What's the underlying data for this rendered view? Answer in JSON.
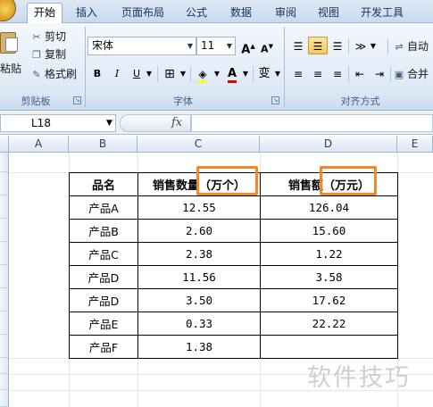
{
  "ribbon_tabs": [
    "开始",
    "插入",
    "页面布局",
    "公式",
    "数据",
    "审阅",
    "视图",
    "开发工具"
  ],
  "clipboard": {
    "paste_label": "粘贴",
    "cut": "剪切",
    "copy": "复制",
    "format_painter": "格式刷",
    "group_title": "剪贴板"
  },
  "font": {
    "name": "宋体",
    "size": "11",
    "grow": "A",
    "shrink": "A",
    "bold": "B",
    "italic": "I",
    "underline": "U",
    "color_letter": "A",
    "phonetic": "变",
    "group_title": "字体"
  },
  "alignment": {
    "wrap_label": "自动",
    "merge_label": "合并",
    "group_title": "对齐方式"
  },
  "formula_bar": {
    "name_box": "L18",
    "fx": "fx",
    "value": ""
  },
  "columns": [
    "A",
    "B",
    "C",
    "D",
    "E"
  ],
  "table": {
    "headers": [
      "品名",
      "销售数量（万个）",
      "销售额（万元）"
    ],
    "rows": [
      [
        "产品A",
        "12.55",
        "126.04"
      ],
      [
        "产品B",
        "2.60",
        "15.60"
      ],
      [
        "产品C",
        "2.38",
        "1.22"
      ],
      [
        "产品D",
        "11.56",
        "3.58"
      ],
      [
        "产品D",
        "3.50",
        "17.62"
      ],
      [
        "产品E",
        "0.33",
        "22.22"
      ],
      [
        "产品F",
        "1.38",
        ""
      ]
    ]
  },
  "watermark": "软件技巧"
}
